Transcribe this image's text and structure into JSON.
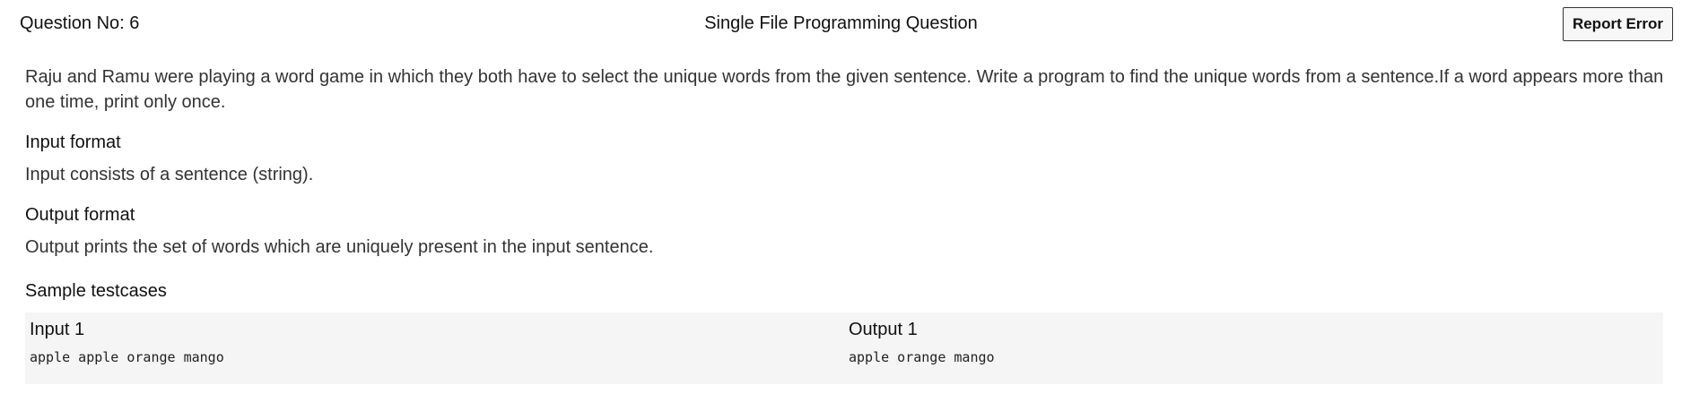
{
  "header": {
    "question_no": "Question No: 6",
    "question_type": "Single File Programming Question",
    "report_button": "Report Error"
  },
  "question": {
    "description": "Raju and Ramu were playing a word game in which they both have to select the unique words from the given sentence. Write a program to find the unique words from a sentence.If a word appears more than one time, print only once.",
    "input_format_heading": "Input format",
    "input_format_text": "Input consists of a sentence (string).",
    "output_format_heading": "Output format",
    "output_format_text": "Output prints the set of words which are uniquely present in the input sentence."
  },
  "testcases": {
    "heading": "Sample testcases",
    "items": [
      {
        "input_label": "Input 1",
        "input_value": "apple apple orange mango",
        "output_label": "Output 1",
        "output_value": "apple orange mango"
      }
    ]
  }
}
